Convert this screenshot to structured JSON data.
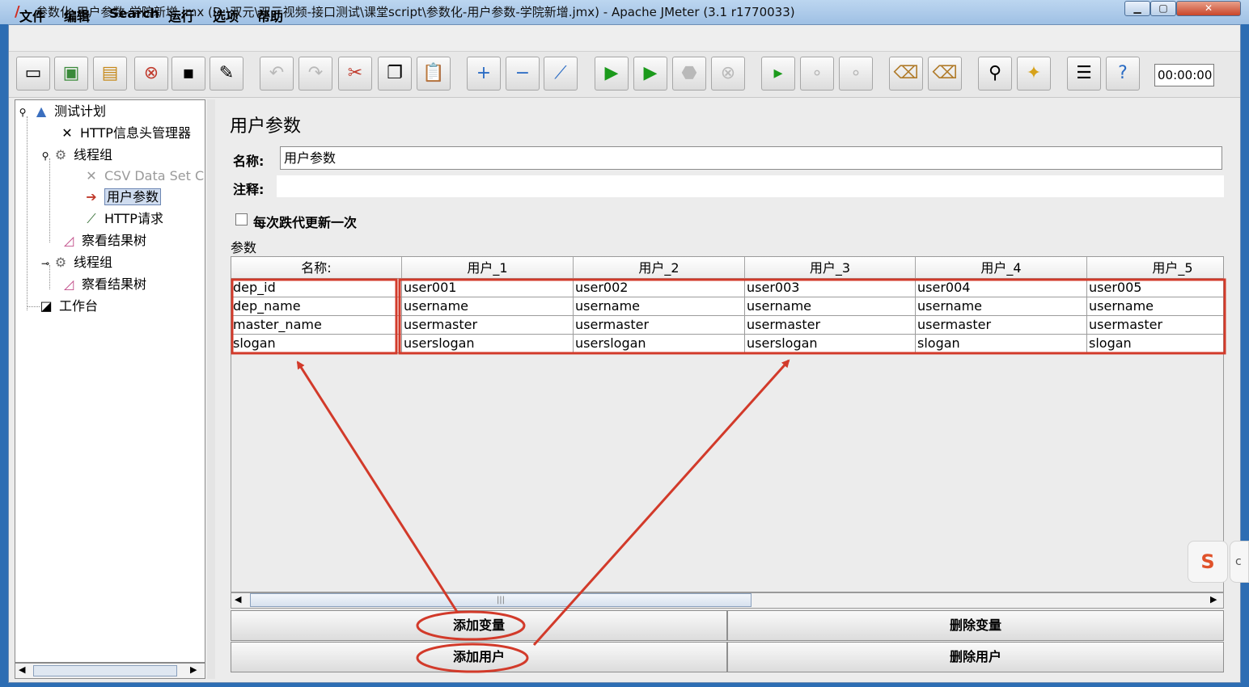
{
  "window": {
    "title": "参数化-用户参数-学院新增.jmx (D:\\双元\\双元视频-接口测试\\课堂script\\参数化-用户参数-学院新增.jmx) - Apache JMeter (3.1 r1770033)"
  },
  "menu": [
    "文件",
    "编辑",
    "Search",
    "运行",
    "选项",
    "帮助"
  ],
  "toolbar": {
    "timer": "00:00:00",
    "icons": [
      "new-icon",
      "templates-icon",
      "open-icon",
      "close-icon",
      "save-icon",
      "save-as-icon",
      "undo-icon",
      "redo-icon",
      "cut-icon",
      "copy-icon",
      "paste-icon",
      "expand-icon",
      "collapse-icon",
      "toggle-icon",
      "start-icon",
      "start-no-pause-icon",
      "stop-icon",
      "shutdown-icon",
      "remote-start-icon",
      "remote-stop-icon",
      "remote-shutdown-icon",
      "clear-icon",
      "clear-all-icon",
      "search-icon",
      "reset-search-icon",
      "function-helper-icon",
      "help-icon"
    ]
  },
  "tree": {
    "items": [
      {
        "label": "测试计划",
        "icon": "test-plan-icon"
      },
      {
        "label": "HTTP信息头管理器",
        "icon": "tools-icon"
      },
      {
        "label": "线程组",
        "icon": "gear-icon"
      },
      {
        "label": "CSV Data Set C",
        "icon": "tools-icon"
      },
      {
        "label": "用户参数",
        "icon": "preprocessor-icon"
      },
      {
        "label": "HTTP请求",
        "icon": "pipette-icon"
      },
      {
        "label": "察看结果树",
        "icon": "graph-icon"
      },
      {
        "label": "线程组",
        "icon": "gear-icon"
      },
      {
        "label": "察看结果树",
        "icon": "graph-icon"
      },
      {
        "label": "工作台",
        "icon": "workbench-icon"
      }
    ]
  },
  "panel": {
    "title": "用户参数",
    "name_label": "名称:",
    "name_value": "用户参数",
    "comment_label": "注释:",
    "comment_value": "",
    "checkbox_label": "每次跌代更新一次",
    "params_label": "参数"
  },
  "table": {
    "headers": [
      "名称:",
      "用户_1",
      "用户_2",
      "用户_3",
      "用户_4",
      "用户_5"
    ],
    "rows": [
      [
        "dep_id",
        "user001",
        "user002",
        "user003",
        "user004",
        "user005"
      ],
      [
        "dep_name",
        "username",
        "username",
        "username",
        "username",
        "username"
      ],
      [
        "master_name",
        "usermaster",
        "usermaster",
        "usermaster",
        "usermaster",
        "usermaster"
      ],
      [
        "slogan",
        "userslogan",
        "userslogan",
        "userslogan",
        "slogan",
        "slogan"
      ]
    ]
  },
  "buttons": {
    "add_var": "添加变量",
    "del_var": "删除变量",
    "add_user": "添加用户",
    "del_user": "删除用户"
  },
  "annotation_color": "#d23a2a"
}
